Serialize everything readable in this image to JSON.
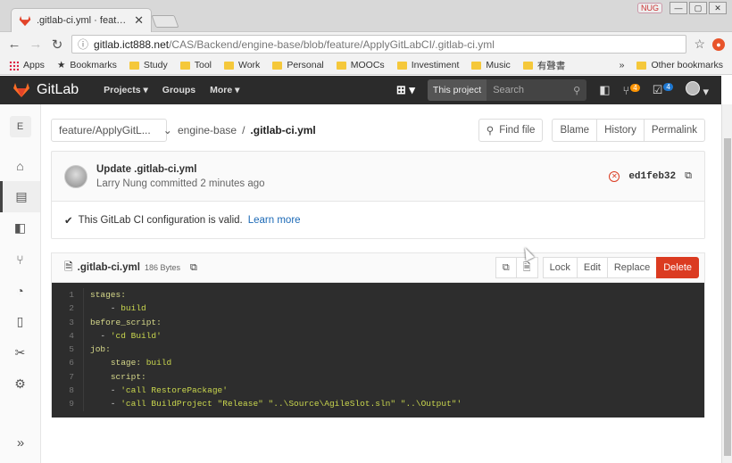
{
  "browser": {
    "tab_title": ".gitlab-ci.yml · feature/Ap",
    "window_user": "NUG",
    "url_domain": "gitlab.ict888.net",
    "url_path": "/CAS/Backend/engine-base/blob/feature/ApplyGitLabCI/.gitlab-ci.yml",
    "bookmarks": [
      "Apps",
      "Bookmarks",
      "Study",
      "Tool",
      "Work",
      "Personal",
      "MOOCs",
      "Investiment",
      "Music",
      "有聲書"
    ],
    "other_bookmarks": "Other bookmarks",
    "overflow": "»"
  },
  "gitlab_nav": {
    "brand": "GitLab",
    "menu": [
      "Projects",
      "Groups",
      "More"
    ],
    "search_scope": "This project",
    "search_placeholder": "Search",
    "issues_count": "4",
    "todos_count": "4"
  },
  "sidebar": {
    "project_letter": "E"
  },
  "toolbar": {
    "branch": "feature/ApplyGitL...",
    "crumb_repo": "engine-base",
    "crumb_sep": "/",
    "crumb_file": ".gitlab-ci.yml",
    "find_file": "Find file",
    "blame": "Blame",
    "history": "History",
    "permalink": "Permalink"
  },
  "commit": {
    "message": "Update .gitlab-ci.yml",
    "author_line": "Larry Nung committed 2 minutes ago",
    "sha": "ed1feb32",
    "ci_status_text": "This GitLab CI configuration is valid.",
    "ci_link": "Learn more"
  },
  "file": {
    "name": ".gitlab-ci.yml",
    "size": "186 Bytes",
    "actions": [
      "Lock",
      "Edit",
      "Replace",
      "Delete"
    ]
  },
  "code_lines": [
    {
      "n": "1",
      "text": "stages:"
    },
    {
      "n": "2",
      "text": "    - build"
    },
    {
      "n": "3",
      "text": "before_script:"
    },
    {
      "n": "4",
      "text": "  - 'cd Build'"
    },
    {
      "n": "5",
      "text": "job:"
    },
    {
      "n": "6",
      "text": "    stage: build"
    },
    {
      "n": "7",
      "text": "    script:"
    },
    {
      "n": "8",
      "text": "    - 'call RestorePackage'"
    },
    {
      "n": "9",
      "text": "    - 'call BuildProject \"Release\" \"..\\Source\\AgileSlot.sln\" \"..\\Output\"'"
    }
  ],
  "colors": {
    "nav_bg": "#2b2b2b",
    "code_bg": "#2d2d2d",
    "delete": "#db3b21",
    "link": "#1b69b6",
    "badge_orange": "#fc9403",
    "badge_blue": "#1f78d1"
  }
}
